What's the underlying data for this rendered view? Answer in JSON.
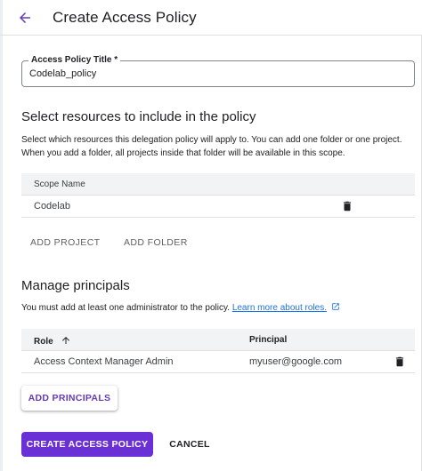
{
  "header": {
    "title": "Create Access Policy",
    "back_icon": "arrow-back-icon"
  },
  "title_field": {
    "label": "Access Policy Title *",
    "value": "Codelab_policy"
  },
  "resources": {
    "heading": "Select resources to include in the policy",
    "description": "Select which resources this delegation policy will apply to. You can add one folder or one project. When you add a folder, all projects inside that folder will be available in this scope.",
    "table": {
      "column": "Scope Name",
      "rows": [
        {
          "name": "Codelab",
          "action_icon": "delete-icon"
        }
      ]
    },
    "add_project_label": "ADD PROJECT",
    "add_folder_label": "ADD FOLDER"
  },
  "principals": {
    "heading": "Manage principals",
    "description": "You must add at least one administrator to the policy.",
    "learn_more": "Learn more about roles.",
    "learn_more_icon": "open-in-new-icon",
    "table": {
      "columns": [
        "Role",
        "Principal"
      ],
      "sort_icon": "arrow-upward-icon",
      "rows": [
        {
          "role": "Access Context Manager Admin",
          "principal": "myuser@google.com",
          "action_icon": "delete-icon"
        }
      ]
    },
    "add_principals_label": "ADD PRINCIPALS"
  },
  "footer": {
    "create_label": "CREATE ACCESS POLICY",
    "cancel_label": "CANCEL"
  },
  "colors": {
    "accent": "#673ab7",
    "primary_button": "#6b2fd6",
    "link": "#1a73e8",
    "table_header_bg": "#f1f3f4"
  }
}
